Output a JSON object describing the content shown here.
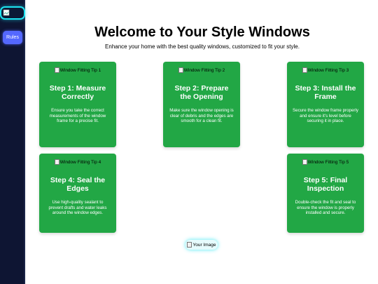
{
  "sidebar": {
    "logo_icon": "broken-image-icon",
    "rules_label": "Rules"
  },
  "header": {
    "title": "Welcome to Your Style Windows",
    "subtitle": "Enhance your home with the best quality windows, customized to fit your style."
  },
  "cards": [
    {
      "image_alt": "Window Fitting Tip 1",
      "title": "Step 1: Measure Correctly",
      "text": "Ensure you take the correct measurements of the window frame for a precise fit."
    },
    {
      "image_alt": "Window Fitting Tip 2",
      "title": "Step 2: Prepare the Opening",
      "text": "Make sure the window opening is clear of debris and the edges are smooth for a clean fit."
    },
    {
      "image_alt": "Window Fitting Tip 3",
      "title": "Step 3: Install the Frame",
      "text": "Secure the window frame properly and ensure it's level before securing it in place."
    },
    {
      "image_alt": "Window Fitting Tip 4",
      "title": "Step 4: Seal the Edges",
      "text": "Use high-quality sealant to prevent drafts and water leaks around the window edges."
    },
    {
      "image_alt": "Window Fitting Tip 5",
      "title": "Step 5: Final Inspection",
      "text": "Double-check the fit and seal to ensure the window is properly installed and secure."
    }
  ],
  "footer_image": {
    "alt": "Your Image"
  },
  "colors": {
    "sidebar_bg": "#0e1533",
    "accent_cyan": "#1de3f0",
    "rules_button": "#5468ff",
    "card_green": "#22a745"
  }
}
